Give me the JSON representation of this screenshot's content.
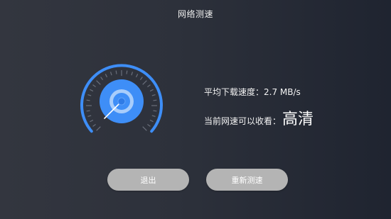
{
  "page": {
    "title": "网络测速"
  },
  "result": {
    "speed_label": "平均下载速度：",
    "speed_value": "2.7 MB/s",
    "quality_label": "当前网速可以收看：",
    "quality_value": "高清"
  },
  "buttons": {
    "exit_label": "退出",
    "retest_label": "重新测速"
  },
  "gauge": {
    "icon": "speedometer-icon",
    "accent_color": "#3e8ef7",
    "tick_color": "#6a6f7b"
  },
  "colors": {
    "button_bg": "#b4b4b4",
    "background_left": "#33363f",
    "background_right": "#1f2430"
  }
}
